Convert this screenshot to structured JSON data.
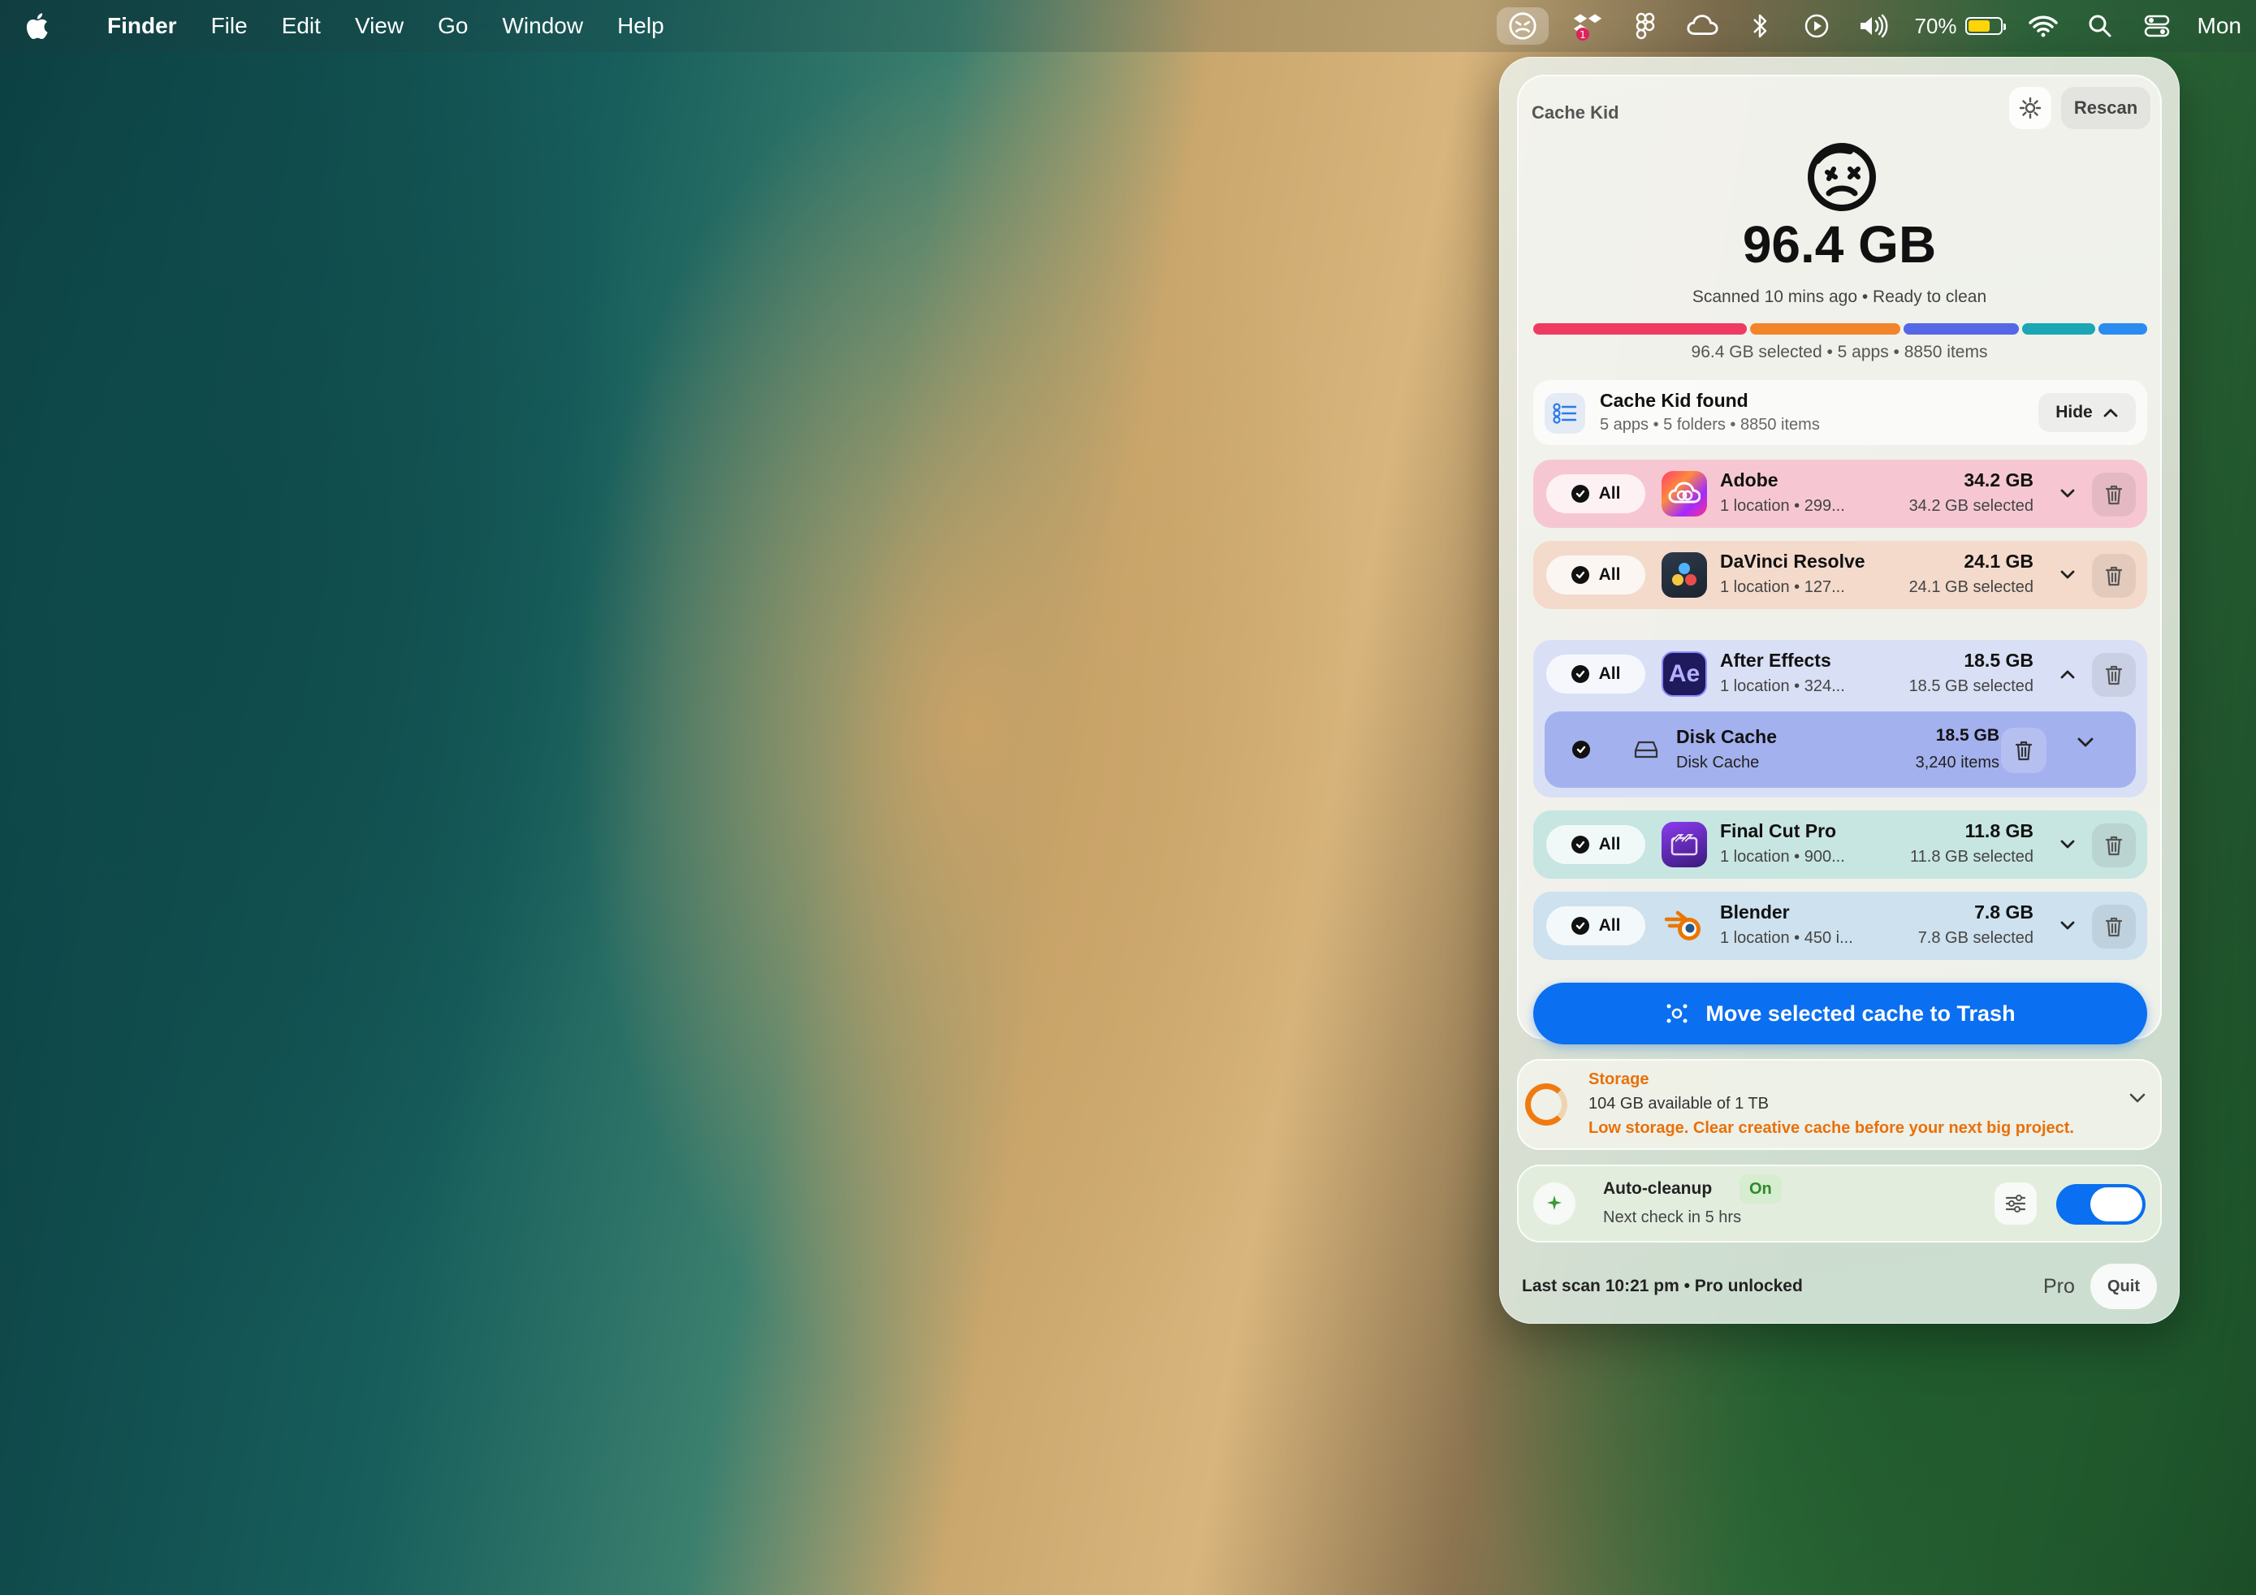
{
  "menubar": {
    "app_name": "Finder",
    "items": [
      "File",
      "Edit",
      "View",
      "Go",
      "Window",
      "Help"
    ],
    "battery_percent": "70%",
    "battery_level": 0.7,
    "clock": "Mon"
  },
  "popover": {
    "title": "Cache Kid",
    "rescan_label": "Rescan",
    "total_size": "96.4 GB",
    "scan_status": "Scanned 10 mins ago • Ready to clean",
    "bar_segments": [
      {
        "color": "#ef3b62",
        "share": 34.2
      },
      {
        "color": "#f2852b",
        "share": 24.1
      },
      {
        "color": "#5468e6",
        "share": 18.5
      },
      {
        "color": "#1aa6b4",
        "share": 11.8
      },
      {
        "color": "#2a8cf0",
        "share": 7.8
      }
    ],
    "selection_summary": "96.4 GB selected • 5 apps • 8850 items",
    "found": {
      "title": "Cache Kid found",
      "subtitle": "5 apps • 5 folders • 8850 items",
      "hide_label": "Hide"
    },
    "all_label": "All",
    "apps": [
      {
        "name": "Adobe",
        "sub": "1 location • 299...",
        "size": "34.2 GB",
        "selected": "34.2 GB selected",
        "bg": "#f6c7d3"
      },
      {
        "name": "DaVinci Resolve",
        "sub": "1 location • 127...",
        "size": "24.1 GB",
        "selected": "24.1 GB selected",
        "bg": "#f4dacb"
      },
      {
        "name": "After Effects",
        "sub": "1 location • 324...",
        "size": "18.5 GB",
        "selected": "18.5 GB selected",
        "bg": "#d9e0f5"
      },
      {
        "name": "Final Cut Pro",
        "sub": "1 location • 900...",
        "size": "11.8 GB",
        "selected": "11.8 GB selected",
        "bg": "#c7e5e1"
      },
      {
        "name": "Blender",
        "sub": "1 location • 450 i...",
        "size": "7.8 GB",
        "selected": "7.8 GB selected",
        "bg": "#cde1ee"
      }
    ],
    "ae_icon_text": "Ae",
    "sub_item": {
      "name": "Disk Cache",
      "desc": "Disk Cache",
      "size": "18.5 GB",
      "count": "3,240 items"
    },
    "cta_label": "Move selected cache to Trash",
    "storage": {
      "label": "Storage",
      "available": "104 GB available of 1 TB",
      "warning": "Low storage. Clear creative cache before your next big project."
    },
    "auto_cleanup": {
      "label": "Auto-cleanup",
      "status": "On",
      "next_check": "Next check in 5 hrs"
    },
    "footer": {
      "last_scan": "Last scan 10:21 pm • Pro unlocked",
      "pro": "Pro",
      "quit": "Quit"
    }
  }
}
